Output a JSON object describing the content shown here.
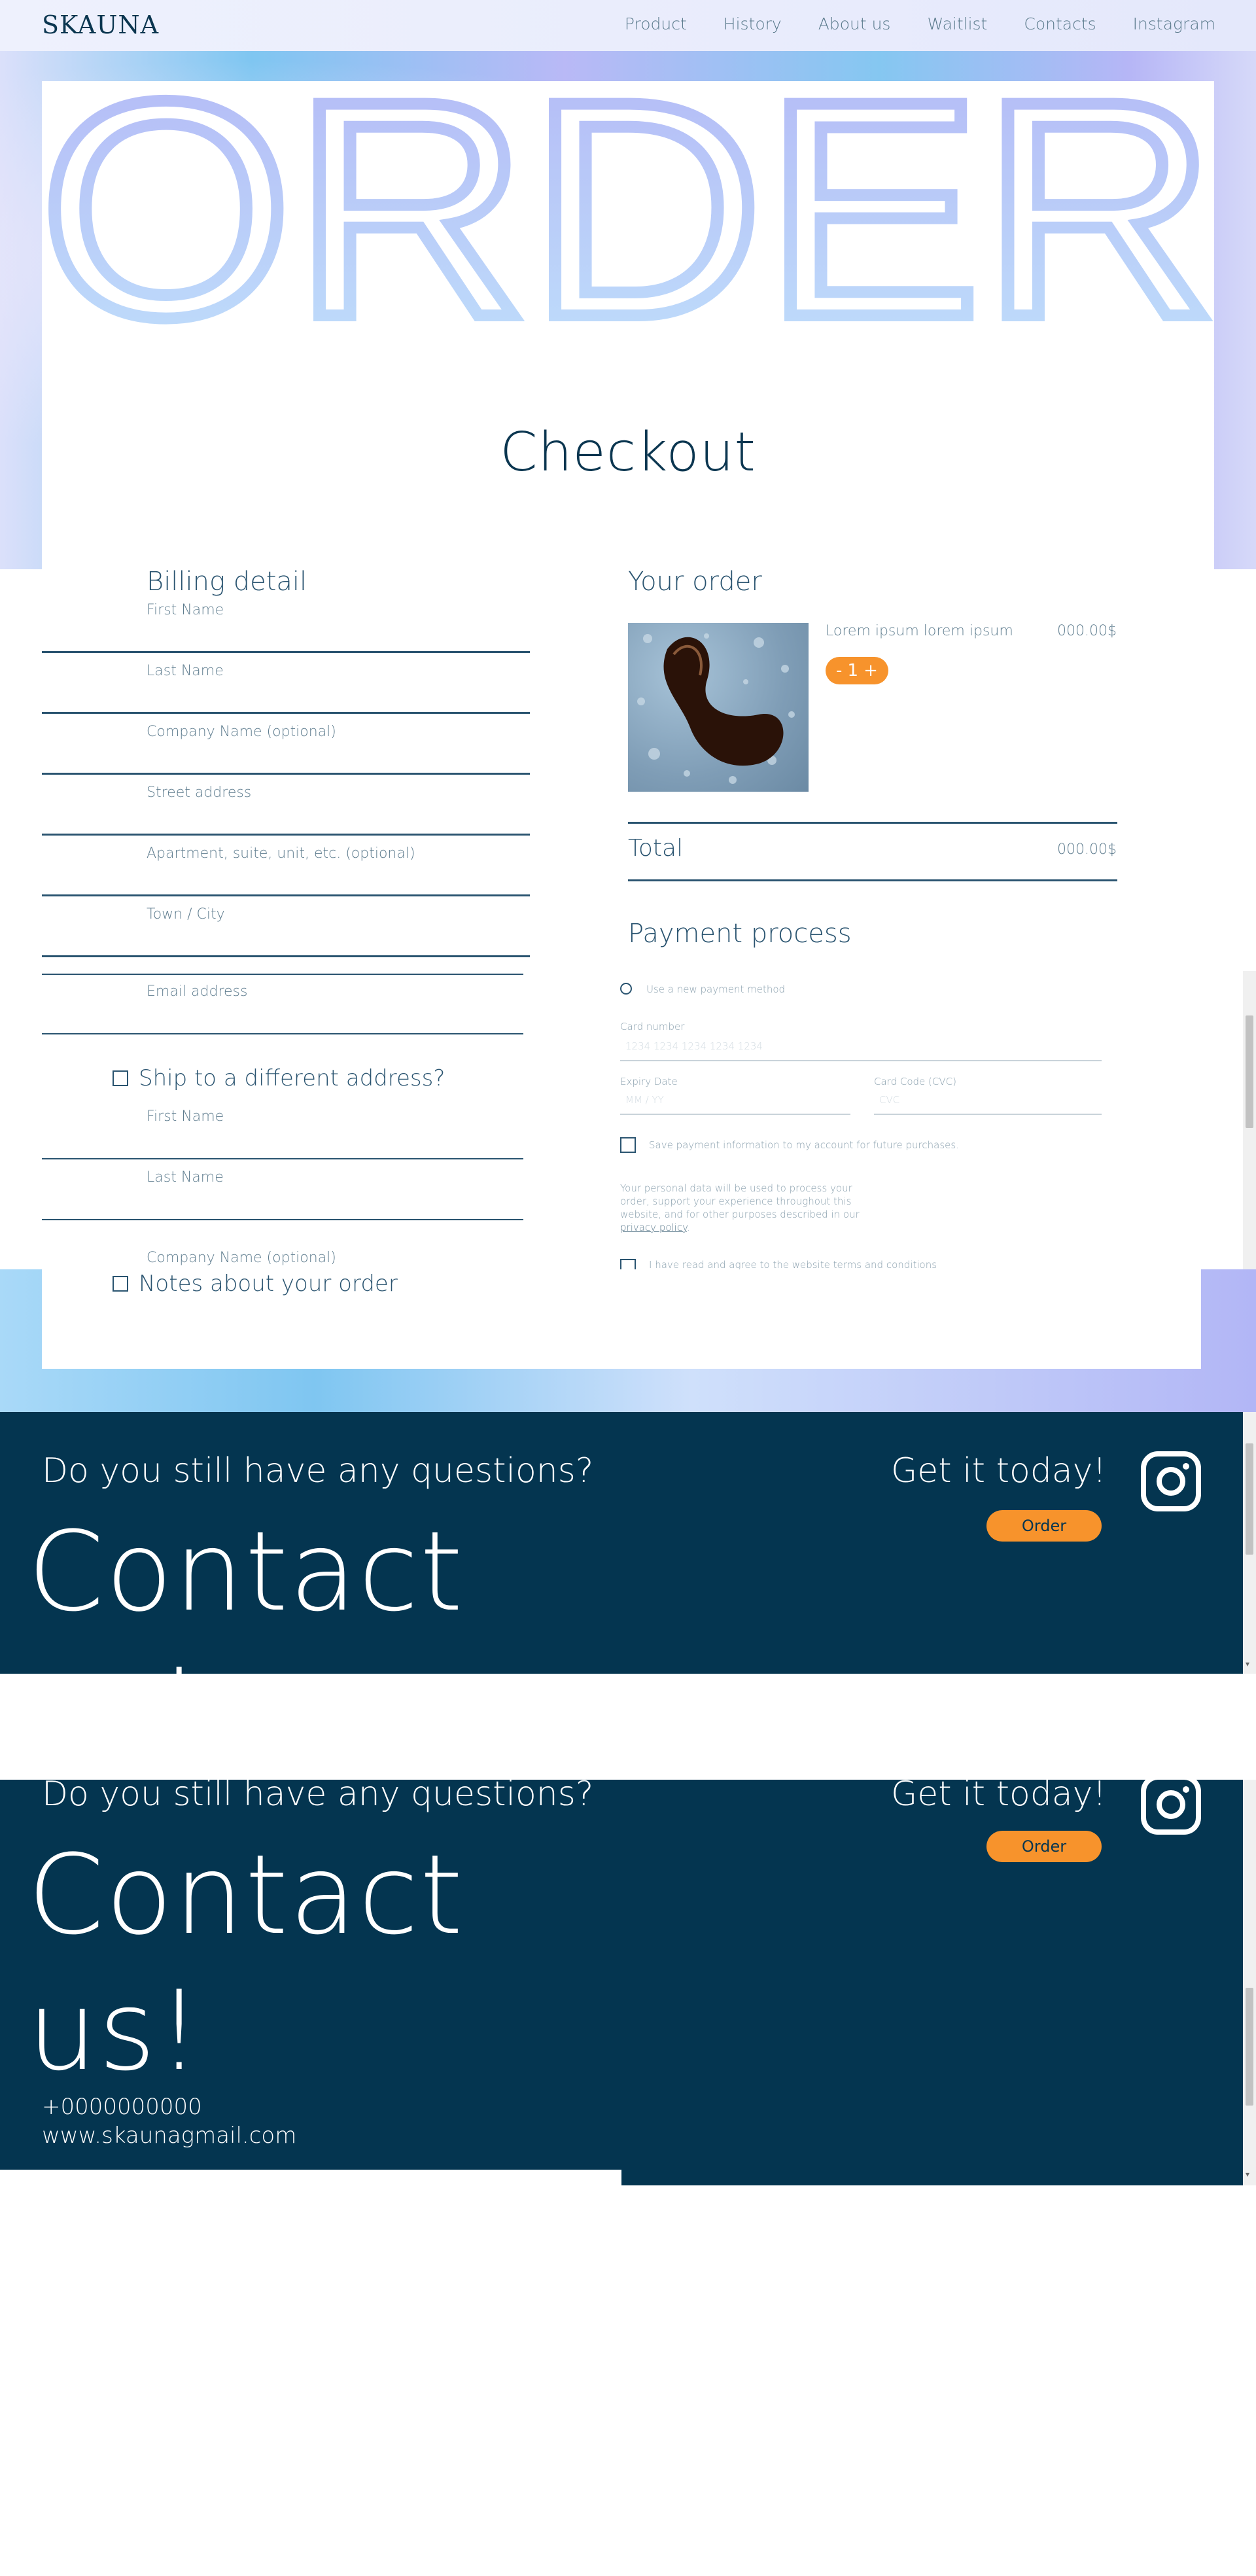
{
  "nav": {
    "logo": "SKAUNA",
    "links": [
      "Product",
      "History",
      "About us",
      "Waitlist",
      "Contacts",
      "Instagram"
    ]
  },
  "hero": {
    "big_word": "ORDER",
    "subtitle": "Checkout"
  },
  "billing": {
    "title": "Billing detail",
    "fields": [
      "First Name",
      "Last Name",
      "Company Name (optional)",
      "Street address",
      "Apartment, suite, unit, etc. (optional)",
      "Town / City"
    ],
    "email_placeholder": "Email address",
    "ship_label": "Ship to a different address?",
    "ship_fields": [
      "First Name",
      "Last Name",
      "Company Name (optional)"
    ],
    "notes_label": "Notes about your order"
  },
  "order": {
    "title": "Your order",
    "product_name": "Lorem ipsum lorem ipsum",
    "product_price": "000.00$",
    "qty_minus": "-",
    "qty_value": "1",
    "qty_plus": "+",
    "total_label": "Total",
    "total_value": "000.00$"
  },
  "payment": {
    "title": "Payment process",
    "new_method": "Use a new payment method",
    "card_number_label": "Card number",
    "card_number_placeholder": "1234 1234 1234 1234 1234",
    "expiry_label": "Expiry Date",
    "expiry_placeholder": "MM / YY",
    "cvc_label": "Card Code (CVC)",
    "cvc_placeholder": "CVC",
    "save_label": "Save payment information to my account for future purchases.",
    "privacy_text": "Your personal data will be used to process your order, support your experience throughout this website, and for other purposes described in our",
    "privacy_link": "privacy policy",
    "terms_label": "I have read and agree to the website terms and conditions"
  },
  "footer": {
    "question": "Do you still have any questions?",
    "contact_line1": "Contact",
    "contact_line2": "us!",
    "get_it": "Get it today!",
    "order_button": "Order",
    "phone": "+0000000000",
    "website": "www.skaunagmail.com"
  },
  "colors": {
    "navy": "#043550",
    "accent_orange": "#f7932c",
    "text_blue": "#2a5470"
  }
}
